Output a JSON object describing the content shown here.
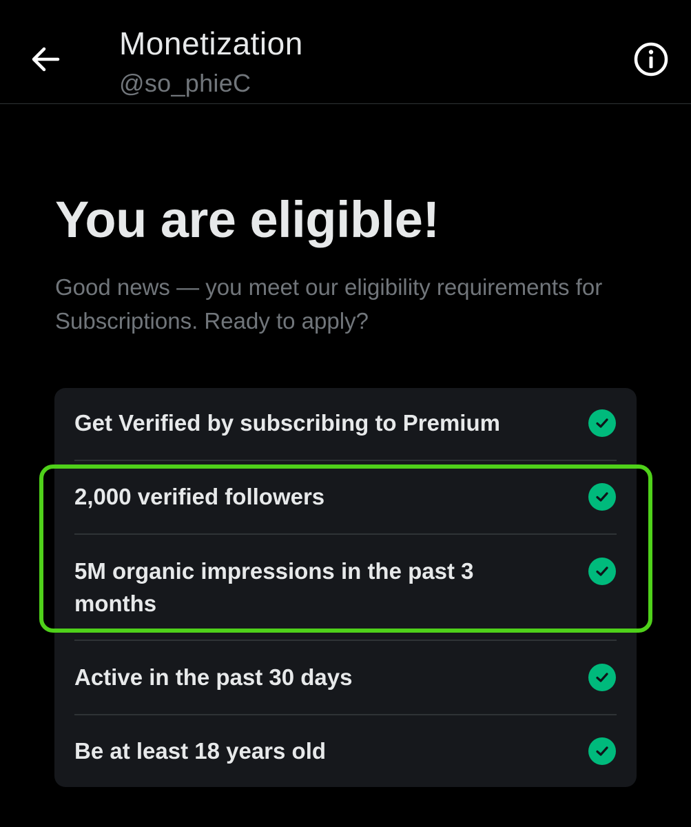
{
  "header": {
    "title": "Monetization",
    "handle": "@so_phieC",
    "back_icon": "arrow-left-icon",
    "info_icon": "info-circle-icon"
  },
  "main": {
    "headline": "You are eligible!",
    "subtext": "Good news — you meet our eligibility requirements for Subscriptions. Ready to apply?"
  },
  "requirements": [
    {
      "label": "Get Verified by subscribing to Premium",
      "met": true
    },
    {
      "label": "2,000 verified followers",
      "met": true
    },
    {
      "label": "5M organic impressions in the past 3 months",
      "met": true
    },
    {
      "label": "Active in the past 30 days",
      "met": true
    },
    {
      "label": "Be at least 18 years old",
      "met": true
    }
  ],
  "colors": {
    "background": "#000000",
    "card": "#16181c",
    "check": "#00ba7c",
    "highlight": "#4fd11a",
    "muted_text": "#71767b"
  }
}
